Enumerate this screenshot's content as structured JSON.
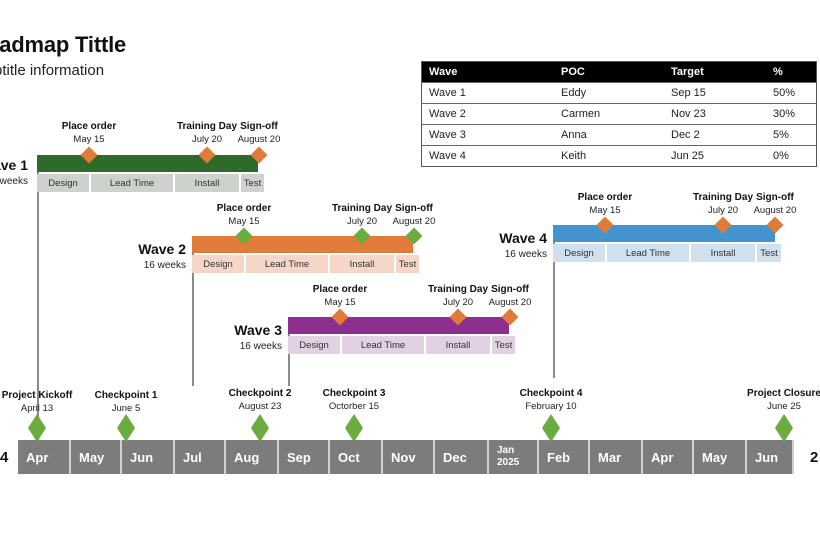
{
  "header": {
    "title": "oadmap Tittle",
    "subtitle": "btitle information"
  },
  "table": {
    "columns": [
      "Wave",
      "POC",
      "Target",
      "%"
    ],
    "rows": [
      [
        "Wave 1",
        "Eddy",
        "Sep 15",
        "50%"
      ],
      [
        "Wave 2",
        "Carmen",
        "Nov 23",
        "30%"
      ],
      [
        "Wave 3",
        "Anna",
        "Dec 2",
        "5%"
      ],
      [
        "Wave 4",
        "Keith",
        "Jun 25",
        "0%"
      ]
    ]
  },
  "waves": [
    {
      "name": "ave 1",
      "duration": "weeks",
      "color": "#2e6b2a",
      "phase_color": "#cdd3cc",
      "marker_color": "#e07b39",
      "milestones": [
        {
          "name": "Place order",
          "date": "May 15"
        },
        {
          "name": "Training Day",
          "date": "July 20"
        },
        {
          "name": "Sign-off",
          "date": "August 20"
        }
      ],
      "phases": [
        "Design",
        "Lead Time",
        "Install",
        "Test"
      ]
    },
    {
      "name": "Wave 2",
      "duration": "16 weeks",
      "color": "#e07b39",
      "phase_color": "#f5d6c8",
      "marker_color": "#6aac3e",
      "milestones": [
        {
          "name": "Place order",
          "date": "May 15"
        },
        {
          "name": "Training Day",
          "date": "July 20"
        },
        {
          "name": "Sign-off",
          "date": "August 20"
        }
      ],
      "phases": [
        "Design",
        "Lead Time",
        "Install",
        "Test"
      ]
    },
    {
      "name": "Wave 3",
      "duration": "16 weeks",
      "color": "#8e2f8f",
      "phase_color": "#e2d1e2",
      "marker_color": "#e07b39",
      "milestones": [
        {
          "name": "Place order",
          "date": "May 15"
        },
        {
          "name": "Training Day",
          "date": "July 20"
        },
        {
          "name": "Sign-off",
          "date": "August 20"
        }
      ],
      "phases": [
        "Design",
        "Lead Time",
        "Install",
        "Test"
      ]
    },
    {
      "name": "Wave 4",
      "duration": "16 weeks",
      "color": "#4393cf",
      "phase_color": "#cfe0ef",
      "marker_color": "#e07b39",
      "milestones": [
        {
          "name": "Place order",
          "date": "May 15"
        },
        {
          "name": "Training Day",
          "date": "July 20"
        },
        {
          "name": "Sign-off",
          "date": "August 20"
        }
      ],
      "phases": [
        "Design",
        "Lead Time",
        "Install",
        "Test"
      ]
    }
  ],
  "timeline": {
    "start_year_fragment": "4",
    "end_year_fragment": "2",
    "months": [
      "Apr",
      "May",
      "Jun",
      "Jul",
      "Aug",
      "Sep",
      "Oct",
      "Nov",
      "Dec",
      "Jan 2025",
      "Feb",
      "Mar",
      "Apr",
      "May",
      "Jun"
    ],
    "month_color": "#7c7c7c",
    "checkpoint_color": "#6aac3e",
    "checkpoints": [
      {
        "name": "Project Kickoff",
        "date": "April 13"
      },
      {
        "name": "Checkpoint 1",
        "date": "June 5"
      },
      {
        "name": "Checkpoint 2",
        "date": "August 23"
      },
      {
        "name": "Checkpoint 3",
        "date": "Octorber 15"
      },
      {
        "name": "Checkpoint 4",
        "date": "February 10"
      },
      {
        "name": "Project Closure",
        "date": "June 25"
      }
    ]
  }
}
